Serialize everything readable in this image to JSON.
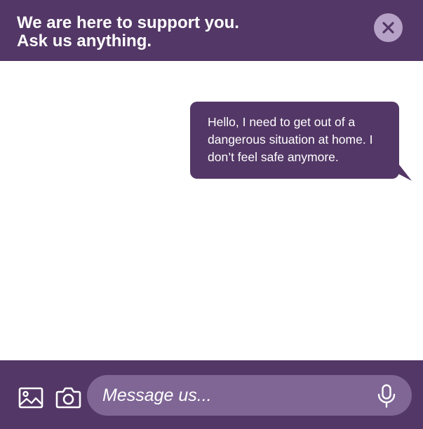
{
  "header": {
    "title_line1": "We are here to support you.",
    "title_line2": "Ask us anything.",
    "close_icon": "close-icon"
  },
  "chat": {
    "messages": [
      {
        "sender": "user",
        "lines": [
          "Hello, I need to get out of a",
          "dangerous situation at home. I",
          "don’t feel safe anymore."
        ]
      }
    ]
  },
  "composer": {
    "placeholder": "Message us...",
    "value": "",
    "icons": [
      "image-icon",
      "camera-icon",
      "microphone-icon"
    ]
  },
  "colors": {
    "brand_purple": "#533766",
    "input_purple": "#7f6695",
    "close_button_bg": "#b6a2c6",
    "text_white": "#ffffff"
  }
}
